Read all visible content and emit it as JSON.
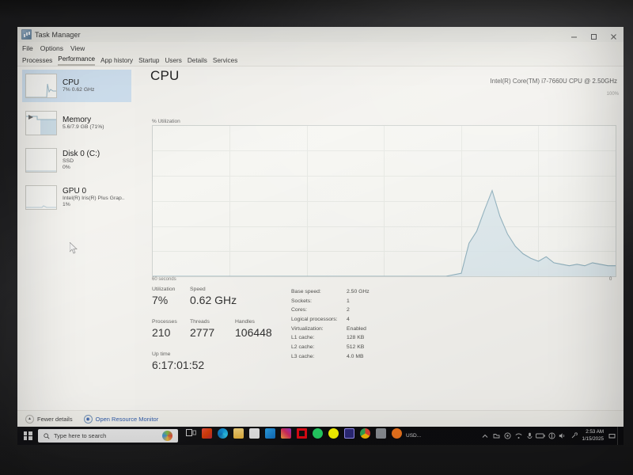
{
  "window": {
    "title": "Task Manager",
    "icon": "task-manager-icon",
    "controls": {
      "minimize": "─",
      "maximize": "❐",
      "close": "✕"
    }
  },
  "menu": [
    "File",
    "Options",
    "View"
  ],
  "tabs": [
    {
      "label": "Processes",
      "active": false
    },
    {
      "label": "Performance",
      "active": true
    },
    {
      "label": "App history",
      "active": false
    },
    {
      "label": "Startup",
      "active": false
    },
    {
      "label": "Users",
      "active": false
    },
    {
      "label": "Details",
      "active": false
    },
    {
      "label": "Services",
      "active": false
    }
  ],
  "sidebar": {
    "items": [
      {
        "name": "CPU",
        "sub1": "7% 0.62 GHz",
        "sub2": "",
        "selected": true
      },
      {
        "name": "Memory",
        "sub1": "5.6/7.9 GB (71%)",
        "sub2": "",
        "selected": false
      },
      {
        "name": "Disk 0 (C:)",
        "sub1": "SSD",
        "sub2": "0%",
        "selected": false
      },
      {
        "name": "GPU 0",
        "sub1": "Intel(R) Iris(R) Plus Grap..",
        "sub2": "1%",
        "selected": false
      }
    ]
  },
  "main": {
    "heading": "CPU",
    "cpu_model": "Intel(R) Core(TM) i7-7660U CPU @ 2.50GHz",
    "y_axis_label": "% Utilization",
    "y_max_label": "100%",
    "x_left_label": "60 seconds",
    "x_right_label": "0"
  },
  "stats": {
    "utilization": {
      "label": "Utilization",
      "value": "7%"
    },
    "speed": {
      "label": "Speed",
      "value": "0.62 GHz"
    },
    "processes": {
      "label": "Processes",
      "value": "210"
    },
    "threads": {
      "label": "Threads",
      "value": "2777"
    },
    "handles": {
      "label": "Handles",
      "value": "106448"
    },
    "uptime": {
      "label": "Up time",
      "value": "6:17:01:52"
    },
    "details": [
      {
        "key": "Base speed:",
        "value": "2.50 GHz"
      },
      {
        "key": "Sockets:",
        "value": "1"
      },
      {
        "key": "Cores:",
        "value": "2"
      },
      {
        "key": "Logical processors:",
        "value": "4"
      },
      {
        "key": "Virtualization:",
        "value": "Enabled"
      },
      {
        "key": "L1 cache:",
        "value": "128 KB"
      },
      {
        "key": "L2 cache:",
        "value": "512 KB"
      },
      {
        "key": "L3 cache:",
        "value": "4.0 MB"
      }
    ]
  },
  "footer": {
    "fewer_details": "Fewer details",
    "resource_monitor": "Open Resource Monitor"
  },
  "taskbar": {
    "start_icon": "windows-logo-icon",
    "search_placeholder": "Type here to search",
    "cortana_icon": "cortana-icon",
    "apps": [
      {
        "name": "task-view-icon",
        "color": "#cfcfcf"
      },
      {
        "name": "office-icon",
        "color": "#d83b01"
      },
      {
        "name": "edge-icon",
        "color": "#0b8fd6"
      },
      {
        "name": "file-explorer-icon",
        "color": "#e8b33a"
      },
      {
        "name": "microsoft-store-icon",
        "color": "#e9e9e9"
      },
      {
        "name": "outlook-icon",
        "color": "#0f6cbd"
      },
      {
        "name": "instagram-icon",
        "color": "#d6295e"
      },
      {
        "name": "netflix-icon",
        "color": "#e50914"
      },
      {
        "name": "whatsapp-icon",
        "color": "#25d366"
      },
      {
        "name": "snapchat-icon",
        "color": "#fffc00"
      },
      {
        "name": "premiere-pro-icon",
        "color": "#2d2a7a"
      },
      {
        "name": "chrome-icon",
        "color": "#1a9c4a"
      },
      {
        "name": "grey-app-icon",
        "color": "#8d9196"
      },
      {
        "name": "orange-app-icon",
        "color": "#f0761e"
      }
    ],
    "tray_text": "USD...",
    "tray_icons": [
      "show-hidden-icons-chevron",
      "onedrive-icon",
      "antivirus-icon",
      "network-icon",
      "microphone-icon",
      "battery-icon",
      "security-icon",
      "volume-icon",
      "settings-icon"
    ],
    "clock_time": "2:53 AM",
    "clock_date": "1/15/2025",
    "notification_icon": "notification-icon"
  },
  "chart_data": {
    "type": "area",
    "title": "CPU % Utilization over 60 seconds",
    "xlabel": "60 seconds",
    "ylabel": "% Utilization",
    "ylim": [
      0,
      100
    ],
    "xlim": [
      0,
      60
    ],
    "grid": true,
    "line_color": "#8fb0bd",
    "fill_color": "#d9e6ec",
    "x": [
      0,
      5,
      10,
      15,
      20,
      25,
      30,
      35,
      38,
      40,
      41,
      42,
      43,
      44,
      45,
      46,
      47,
      48,
      49,
      50,
      51,
      52,
      53,
      54,
      55,
      56,
      57,
      58,
      59,
      60
    ],
    "values": [
      0,
      0,
      0,
      0,
      0,
      0,
      0,
      0,
      0,
      2,
      22,
      30,
      44,
      57,
      40,
      28,
      20,
      15,
      12,
      10,
      13,
      9,
      8,
      7,
      8,
      7,
      9,
      8,
      7,
      7
    ]
  }
}
